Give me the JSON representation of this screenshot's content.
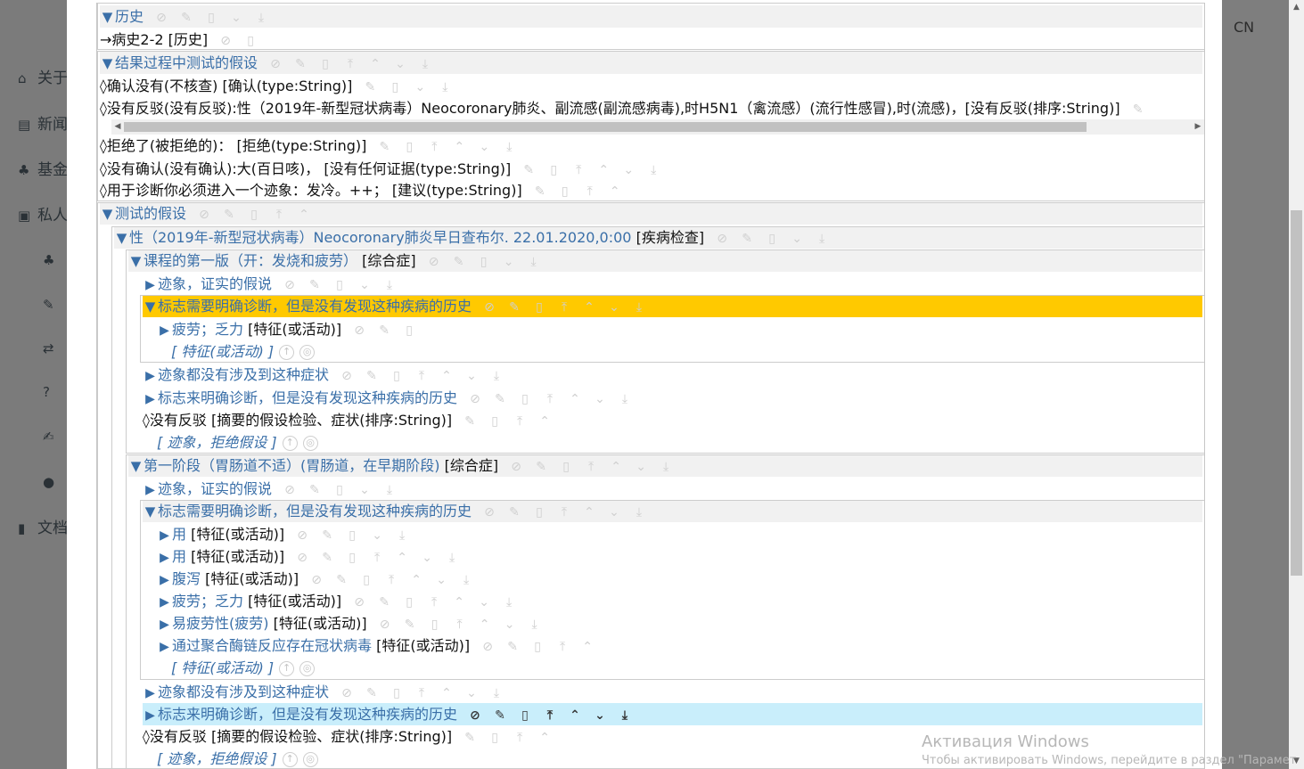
{
  "background": {
    "sidebar_items": [
      {
        "icon": "home-icon",
        "glyph": "⌂",
        "label": "关于"
      },
      {
        "icon": "news-icon",
        "glyph": "▤",
        "label": "新闻"
      },
      {
        "icon": "hierarchy-icon",
        "glyph": "♣",
        "label": "基金"
      },
      {
        "icon": "briefcase-icon",
        "glyph": "▣",
        "label": "私人"
      }
    ],
    "sub_icons": [
      "hierarchy-icon",
      "wrench-icon",
      "shuffle-icon",
      "question-icon",
      "edit-icon",
      "user-icon"
    ],
    "sub_glyphs": [
      "♣",
      "✎",
      "⇄",
      "?",
      "✍",
      "●"
    ],
    "doc_item": {
      "icon": "book-icon",
      "glyph": "▮",
      "label": "文档"
    },
    "lang": "CN"
  },
  "tree": {
    "rows": [
      {
        "indent": 0,
        "marker": "▼",
        "label": "历史",
        "actions": [
          "link",
          "edit",
          "delete",
          "down",
          "bottom"
        ]
      },
      {
        "indent": 0,
        "marker": "→",
        "plain": true,
        "label": "病史2-2",
        "type": "[历史]",
        "actions": [
          "link",
          "delete"
        ]
      },
      {
        "indent": 0,
        "marker": "▼",
        "label": "结果过程中测试的假设",
        "actions": [
          "link",
          "edit",
          "delete",
          "top",
          "up",
          "down",
          "bottom"
        ]
      },
      {
        "indent": 0,
        "marker": "◊",
        "plain": true,
        "label": "确认没有(不核查)",
        "type": "[确认(type:String)]",
        "actions": [
          "edit",
          "delete",
          "down",
          "bottom"
        ]
      },
      {
        "indent": 0,
        "marker": "◊",
        "plain": true,
        "label": "没有反驳(没有反驳):性（2019年-新型冠状病毒）Neocoronary肺炎、副流感(副流感病毒),时H5N1（禽流感）(流行性感冒),时(流感)，[没有反驳(排序:String)]",
        "type": "",
        "actions": [
          "edit"
        ]
      },
      {
        "indent": 0,
        "marker": "◊",
        "plain": true,
        "label": "拒绝了(被拒绝的)：",
        "type": "[拒绝(type:String)]",
        "actions": [
          "edit",
          "delete",
          "top",
          "up",
          "down",
          "bottom"
        ]
      },
      {
        "indent": 0,
        "marker": "◊",
        "plain": true,
        "label": "没有确认(没有确认):大(百日咳)，",
        "type": "[没有任何证据(type:String)]",
        "actions": [
          "edit",
          "delete",
          "top",
          "up",
          "down",
          "bottom"
        ]
      },
      {
        "indent": 0,
        "marker": "◊",
        "plain": true,
        "label": "用于诊断你必须进入一个迹象：发冷。++；",
        "type": "[建议(type:String)]",
        "actions": [
          "edit",
          "delete",
          "top",
          "up"
        ]
      },
      {
        "indent": 0,
        "marker": "▼",
        "label": "测试的假设",
        "actions": [
          "link",
          "edit",
          "delete",
          "top",
          "up"
        ]
      },
      {
        "indent": 1,
        "marker": "▼",
        "label": "性（2019年-新型冠状病毒）Neocoronary肺炎早日查布尔. 22.01.2020,0:00",
        "type": "[疾病检查]",
        "actions": [
          "link",
          "edit",
          "delete",
          "down",
          "bottom"
        ]
      },
      {
        "indent": 2,
        "marker": "▼",
        "label": "课程的第一版（开：发烧和疲劳）",
        "type": "[综合症]",
        "actions": [
          "link",
          "edit",
          "delete",
          "down",
          "bottom"
        ]
      },
      {
        "indent": 3,
        "marker": "▶",
        "label": "迹象，证实的假说",
        "actions": [
          "link",
          "edit",
          "delete",
          "down",
          "bottom"
        ]
      },
      {
        "indent": 3,
        "marker": "▼",
        "label": "标志需要明确诊断，但是没有发现这种疾病的历史",
        "highlight": "orange",
        "actions": [
          "link",
          "edit",
          "delete",
          "top",
          "up",
          "down",
          "bottom"
        ]
      },
      {
        "indent": 4,
        "marker": "▶",
        "label": "疲劳；乏力",
        "type": "[特征(或活动)]",
        "actions": [
          "link",
          "edit",
          "delete"
        ]
      },
      {
        "indent": 4,
        "placeholder": "[ 特征(或活动) ]"
      },
      {
        "indent": 3,
        "marker": "▶",
        "label": "迹象都没有涉及到这种症状",
        "actions": [
          "link",
          "edit",
          "delete",
          "top",
          "up",
          "down",
          "bottom"
        ]
      },
      {
        "indent": 3,
        "marker": "▶",
        "label": "标志来明确诊断，但是没有发现这种疾病的历史",
        "actions": [
          "link",
          "edit",
          "delete",
          "top",
          "up",
          "down",
          "bottom"
        ]
      },
      {
        "indent": 3,
        "marker": "◊",
        "plain": true,
        "label": "没有反驳",
        "type": "[摘要的假设检验、症状(排序:String)]",
        "actions": [
          "edit",
          "delete",
          "top",
          "up"
        ]
      },
      {
        "indent": 3,
        "placeholder": "[ 迹象，拒绝假设 ]"
      },
      {
        "indent": 2,
        "marker": "▼",
        "label": "第一阶段（胃肠道不适）(胃肠道，在早期阶段)",
        "type": "[综合症]",
        "actions": [
          "link",
          "edit",
          "delete",
          "top",
          "up",
          "down",
          "bottom"
        ]
      },
      {
        "indent": 3,
        "marker": "▶",
        "label": "迹象，证实的假说",
        "actions": [
          "link",
          "edit",
          "delete",
          "down",
          "bottom"
        ]
      },
      {
        "indent": 3,
        "marker": "▼",
        "label": "标志需要明确诊断，但是没有发现这种疾病的历史",
        "actions": [
          "link",
          "edit",
          "delete",
          "top",
          "up",
          "down",
          "bottom"
        ]
      },
      {
        "indent": 4,
        "marker": "▶",
        "label": "用",
        "type": "[特征(或活动)]",
        "actions": [
          "link",
          "edit",
          "delete",
          "down",
          "bottom"
        ]
      },
      {
        "indent": 4,
        "marker": "▶",
        "label": "用",
        "type": "[特征(或活动)]",
        "actions": [
          "link",
          "edit",
          "delete",
          "top",
          "up",
          "down",
          "bottom"
        ]
      },
      {
        "indent": 4,
        "marker": "▶",
        "label": "腹泻",
        "type": "[特征(或活动)]",
        "actions": [
          "link",
          "edit",
          "delete",
          "top",
          "up",
          "down",
          "bottom"
        ]
      },
      {
        "indent": 4,
        "marker": "▶",
        "label": "疲劳；乏力",
        "type": "[特征(或活动)]",
        "actions": [
          "link",
          "edit",
          "delete",
          "top",
          "up",
          "down",
          "bottom"
        ]
      },
      {
        "indent": 4,
        "marker": "▶",
        "label": "易疲劳性(疲劳)",
        "type": "[特征(或活动)]",
        "actions": [
          "link",
          "edit",
          "delete",
          "top",
          "up",
          "down",
          "bottom"
        ]
      },
      {
        "indent": 4,
        "marker": "▶",
        "label": "通过聚合酶链反应存在冠状病毒",
        "type": "[特征(或活动)]",
        "actions": [
          "link",
          "edit",
          "delete",
          "top",
          "up"
        ]
      },
      {
        "indent": 4,
        "placeholder": "[ 特征(或活动) ]"
      },
      {
        "indent": 3,
        "marker": "▶",
        "label": "迹象都没有涉及到这种症状",
        "actions": [
          "link",
          "edit",
          "delete",
          "top",
          "up",
          "down",
          "bottom"
        ]
      },
      {
        "indent": 3,
        "marker": "▶",
        "label": "标志来明确诊断，但是没有发现这种疾病的历史",
        "highlight": "blue",
        "active": true,
        "actions": [
          "link",
          "edit",
          "delete",
          "top",
          "up",
          "down",
          "bottom"
        ]
      },
      {
        "indent": 3,
        "marker": "◊",
        "plain": true,
        "label": "没有反驳",
        "type": "[摘要的假设检验、症状(排序:String)]",
        "actions": [
          "edit",
          "delete",
          "top",
          "up"
        ]
      },
      {
        "indent": 3,
        "placeholder": "[ 迹象，拒绝假设 ]"
      }
    ]
  },
  "icons": {
    "link": "link-icon",
    "edit": "pencil-icon",
    "delete": "trash-icon",
    "top": "move-top-icon",
    "up": "move-up-icon",
    "down": "move-down-icon",
    "bottom": "move-bottom-icon"
  },
  "glyphs": {
    "link": "⊘",
    "edit": "✎",
    "delete": "▯",
    "top": "⤒",
    "up": "⌃",
    "down": "⌄",
    "bottom": "⤓"
  },
  "placeholder_icons": [
    "up-circle-icon",
    "ring-icon"
  ],
  "watermark": {
    "line1": "Активация Windows",
    "line2": "Чтобы активировать Windows, перейдите в раздел \"Парамет"
  }
}
